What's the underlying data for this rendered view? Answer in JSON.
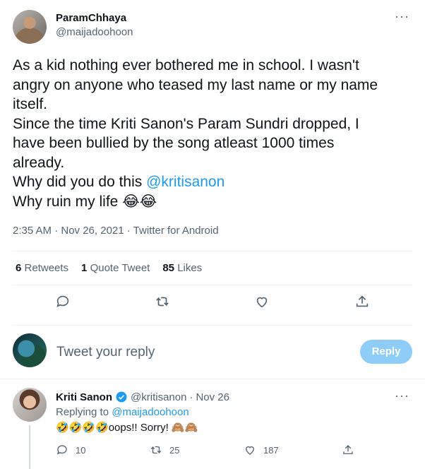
{
  "tweet": {
    "author_name": "ParamChhaya",
    "author_handle": "@maijadoohoon",
    "lines": [
      "As a kid nothing ever bothered me in school. I wasn't",
      "angry on anyone who teased my last name or my name",
      "itself.",
      "Since the time Kriti Sanon's Param Sundri dropped, I",
      "have been bullied by the song atleast 1000 times",
      "already."
    ],
    "line_why_did": "Why did you do this ",
    "mention": "@kritisanon",
    "line_ruin": "Why ruin my life 😂😂",
    "meta": "2:35 AM · Nov 26, 2021 · Twitter for Android",
    "retweets_count": "6",
    "retweets_label": "Retweets",
    "quotes_count": "1",
    "quotes_label": "Quote Tweet",
    "likes_count": "85",
    "likes_label": "Likes",
    "more": "···"
  },
  "reply_box": {
    "placeholder": "Tweet your reply",
    "button_label": "Reply"
  },
  "reply": {
    "author_name": "Kriti Sanon",
    "author_handle": "@kritisanon",
    "dot": "·",
    "date": "Nov 26",
    "replying_prefix": "Replying to ",
    "replying_to": "@maijadoohoon",
    "text": "🤣🤣🤣🤣oops!! Sorry! 🙈🙈",
    "reply_count": "10",
    "retweet_count": "25",
    "like_count": "187",
    "more": "···"
  },
  "colors": {
    "accent": "#1d9bf0",
    "muted": "#536471",
    "reply_button": "#8ecdf7"
  }
}
